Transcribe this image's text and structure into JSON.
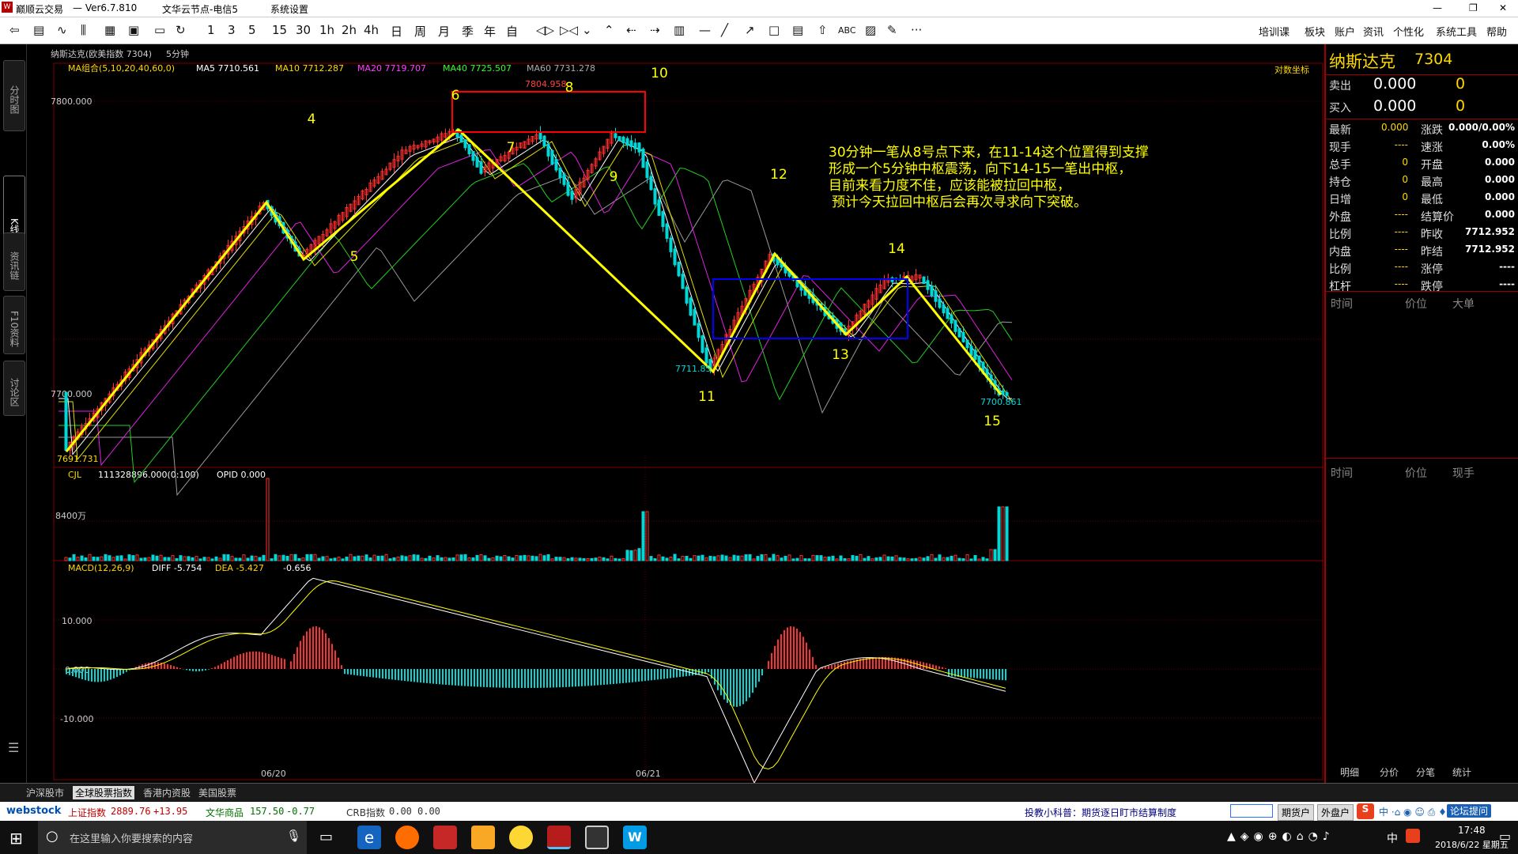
{
  "titlebar": {
    "app_name": "巅顺云交易",
    "version": "— Ver6.7.810",
    "server": "文华云节点-电信5",
    "menu_system": "系统设置",
    "min": "—",
    "restore": "❐",
    "close": "✕"
  },
  "toolbar": {
    "periods": [
      "1",
      "3",
      "5",
      "15",
      "30",
      "1h",
      "2h",
      "4h",
      "日",
      "周",
      "月",
      "季",
      "年",
      "自"
    ],
    "abc": "ABC",
    "more": "···",
    "right_menu": [
      "培训课",
      "板块",
      "账户",
      "资讯",
      "个性化",
      "系统工具",
      "帮助"
    ]
  },
  "left_tabs": [
    "分时图",
    "K线图",
    "资讯链",
    "F10资料",
    "讨论区"
  ],
  "chart_header": {
    "instrument": "纳斯达克(欧美指数 7304)",
    "period": "5分钟",
    "ma_label": "MA组合(5,10,20,40,60,0)",
    "ma5": "MA5 7710.561",
    "ma10": "MA10 7712.287",
    "ma20": "MA20 7719.707",
    "ma40": "MA40 7725.507",
    "ma60": "MA60 7731.278",
    "log_scale": "对数坐标",
    "price_7800": "7800.000",
    "price_7700": "7700.000",
    "vol_label": "CJL",
    "vol_value": "111328896.000(0:100)",
    "opid": "OPID 0.000",
    "vol_axis": "8400万",
    "macd_label": "MACD(12,26,9)",
    "diff": "DIFF -5.754",
    "dea": "DEA -5.427",
    "macd_val": "-0.656",
    "macd_10": "10.000",
    "macd_0": "0.000",
    "macd_m10": "-10.000",
    "date1": "06/20",
    "date2": "06/21",
    "high_label": "7804.958",
    "low_label1": "7711.85",
    "low_label2": "7700.861",
    "start_label": "7691.731"
  },
  "annotation": {
    "line1": "30分钟一笔从8号点下来，在11-14这个位置得到支撑",
    "line2": "形成一个5分钟中枢震荡，向下14-15一笔出中枢，",
    "line3": "目前来看力度不佳，应该能被拉回中枢，",
    "line4": "预计今天拉回中枢后会再次寻求向下突破。"
  },
  "wave_numbers": [
    "4",
    "5",
    "6",
    "7",
    "8",
    "9",
    "10",
    "11",
    "12",
    "13",
    "14",
    "15"
  ],
  "right_panel": {
    "name": "纳斯达克",
    "code": "7304",
    "sell_label": "卖出",
    "sell_price": "0.000",
    "sell_qty": "0",
    "buy_label": "买入",
    "buy_price": "0.000",
    "buy_qty": "0",
    "rows": [
      {
        "l": "最新",
        "v": "0.000",
        "l2": "涨跌",
        "v2": "0.000/0.00%"
      },
      {
        "l": "现手",
        "v": "----",
        "l2": "速涨",
        "v2": "0.00%"
      },
      {
        "l": "总手",
        "v": "0",
        "l2": "开盘",
        "v2": "0.000"
      },
      {
        "l": "持仓",
        "v": "0",
        "l2": "最高",
        "v2": "0.000"
      },
      {
        "l": "日增",
        "v": "0",
        "l2": "最低",
        "v2": "0.000"
      },
      {
        "l": "外盘",
        "v": "----",
        "l2": "结算价",
        "v2": "0.000"
      },
      {
        "l": "比例",
        "v": "----",
        "l2": "昨收",
        "v2": "7712.952"
      },
      {
        "l": "内盘",
        "v": "----",
        "l2": "昨结",
        "v2": "7712.952"
      },
      {
        "l": "比例",
        "v": "----",
        "l2": "涨停",
        "v2": "----"
      },
      {
        "l": "杠杆",
        "v": "----",
        "l2": "跌停",
        "v2": "----"
      }
    ],
    "tick_headers": [
      "时间",
      "价位",
      "大单"
    ],
    "tick_headers2": [
      "时间",
      "价位",
      "现手"
    ],
    "bottom_tabs": [
      "明细",
      "分价",
      "分笔",
      "统计"
    ]
  },
  "bottom_tabs": [
    "沪深股市",
    "全球股票指数",
    "香港内资股",
    "美国股票"
  ],
  "statusbar": {
    "brand": "webstock",
    "idx1_name": "上证指数",
    "idx1_val": "2889.76",
    "idx1_chg": "+13.95",
    "idx2_name": "文华商品",
    "idx2_val": "157.50",
    "idx2_chg": "-0.77",
    "idx3_name": "CRB指数",
    "idx3_val": "0.00",
    "idx3_chg": "0.00",
    "notice": "投教小科普：期货逐日盯市结算制度",
    "btn1": "期货户",
    "btn2": "外盘户",
    "forum": "论坛提问"
  },
  "taskbar": {
    "search_placeholder": "在这里输入你要搜索的内容",
    "time": "17:48",
    "date": "2018/6/22 星期五",
    "ime": "中"
  },
  "colors": {
    "yellow": "#ffff00",
    "red_box": "#ff0000",
    "blue_box": "#0000ff",
    "up": "#ff3030",
    "down": "#00d8d8"
  }
}
